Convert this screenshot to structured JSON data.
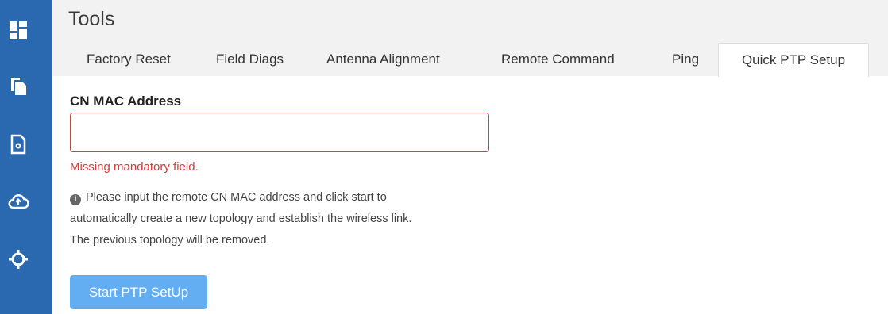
{
  "sidebar": {
    "items": [
      {
        "icon": "dashboard-icon"
      },
      {
        "icon": "copy-icon"
      },
      {
        "icon": "file-settings-icon"
      },
      {
        "icon": "cloud-upload-icon"
      },
      {
        "icon": "crosshair-icon"
      }
    ],
    "color": "#2a68b0"
  },
  "header": {
    "title": "Tools",
    "tabs": [
      {
        "label": "Factory Reset"
      },
      {
        "label": "Field Diags"
      },
      {
        "label": "Antenna Alignment"
      },
      {
        "label": "Remote Command"
      },
      {
        "label": "Ping"
      },
      {
        "label": "Quick PTP Setup",
        "active": true
      }
    ]
  },
  "form": {
    "mac_label": "CN MAC Address",
    "mac_value": "",
    "error": "Missing mandatory field.",
    "help_lines": [
      "Please input the remote CN MAC address and click start to",
      "automatically create a new topology and establish the wireless link.",
      "The previous topology will be removed."
    ],
    "start_button": "Start PTP SetUp"
  },
  "colors": {
    "accent_button": "#63aef2",
    "error": "#d83a3a"
  }
}
